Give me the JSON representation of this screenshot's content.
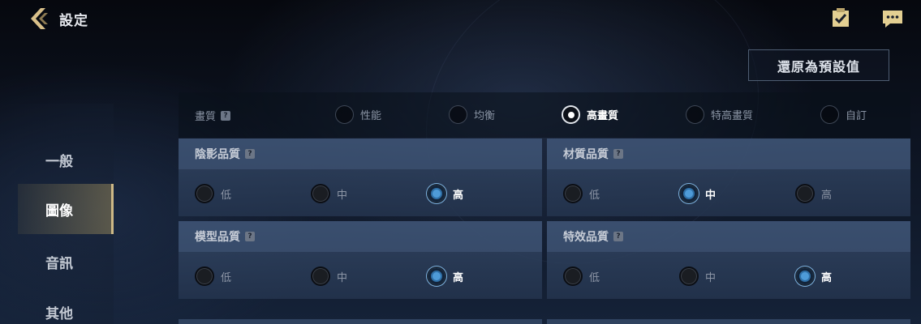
{
  "header": {
    "title": "設定",
    "reset_label": "還原為預設值"
  },
  "icons": {
    "back": "chevron-left-icon",
    "checklist": "clipboard-check-icon",
    "chat": "chat-bubble-icon"
  },
  "colors": {
    "accent_gold": "#cdb886",
    "radio_blue": "#4e9bd8",
    "card_bg": "#34486a"
  },
  "sidebar": {
    "items": [
      {
        "label": "一般",
        "active": false
      },
      {
        "label": "圖像",
        "active": true
      },
      {
        "label": "音訊",
        "active": false
      },
      {
        "label": "其他",
        "active": false
      }
    ]
  },
  "quality": {
    "label": "畫質",
    "options": [
      "性能",
      "均衡",
      "高畫質",
      "特高畫質",
      "自訂"
    ],
    "selected": "高畫質"
  },
  "cards": [
    {
      "title": "陰影品質",
      "options": [
        "低",
        "中",
        "高"
      ],
      "selected": "高"
    },
    {
      "title": "材質品質",
      "options": [
        "低",
        "中",
        "高"
      ],
      "selected": "中"
    },
    {
      "title": "模型品質",
      "options": [
        "低",
        "中",
        "高"
      ],
      "selected": "高"
    },
    {
      "title": "特效品質",
      "options": [
        "低",
        "中",
        "高"
      ],
      "selected": "高"
    }
  ]
}
